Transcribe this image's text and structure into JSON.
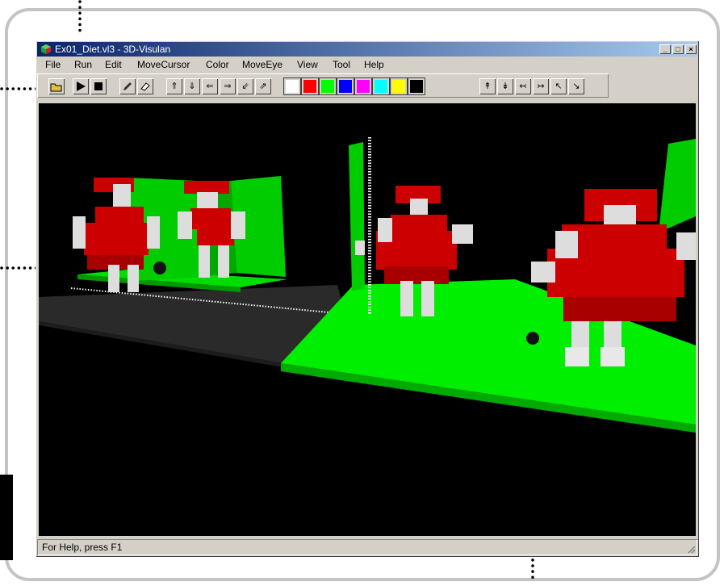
{
  "window": {
    "title": "Ex01_Diet.vl3 - 3D-Visulan",
    "controls": {
      "minimize": "_",
      "maximize": "□",
      "close": "×"
    }
  },
  "menu": [
    "File",
    "Run",
    "Edit",
    "MoveCursor",
    "Color",
    "MoveEye",
    "View",
    "Tool",
    "Help"
  ],
  "toolbar": {
    "buttons": {
      "open": "open-icon",
      "run": "play-icon",
      "stop": "stop-icon",
      "pencil": "pencil-icon",
      "eraser": "eraser-icon",
      "cursor_up": "cursor-up-icon",
      "cursor_down": "cursor-down-icon",
      "cursor_left": "cursor-left-icon",
      "cursor_right": "cursor-right-icon",
      "cursor_back": "cursor-diagonal-back-icon",
      "cursor_forward": "cursor-diagonal-forward-icon",
      "eye_up": "eye-up-icon",
      "eye_down": "eye-down-icon",
      "eye_left": "eye-left-icon",
      "eye_right": "eye-right-icon",
      "eye_in": "eye-in-icon",
      "eye_out": "eye-out-icon"
    },
    "colors": [
      "#ffffff",
      "#ff0000",
      "#00ff00",
      "#0000ff",
      "#ff00ff",
      "#00ffff",
      "#ffff00",
      "#000000"
    ],
    "selected_color": "#00ff00"
  },
  "status": {
    "text": "For Help, press F1"
  }
}
